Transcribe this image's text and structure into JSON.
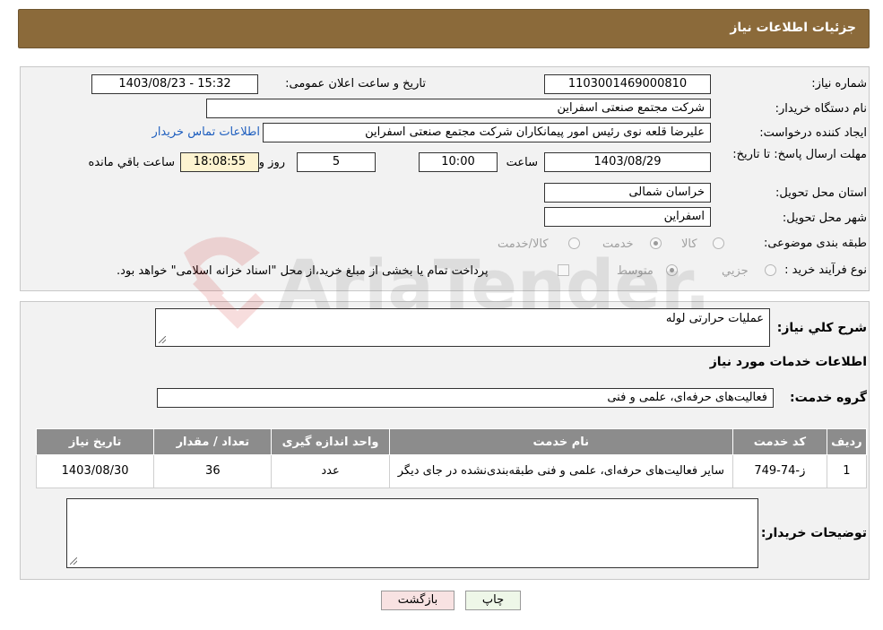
{
  "header": {
    "title": "جزئیات اطلاعات نیاز"
  },
  "labels": {
    "need_number": "شماره نیاز:",
    "announce_datetime": "تاریخ و ساعت اعلان عمومی:",
    "buyer_org": "نام دستگاه خریدار:",
    "requester": "ایجاد کننده درخواست:",
    "buyer_contact": "اطلاعات تماس خریدار",
    "deadline": "مهلت ارسال پاسخ: تا تاریخ:",
    "hour": "ساعت",
    "day_and": "روز و",
    "remaining": "ساعت باقي مانده",
    "province": "استان محل تحویل:",
    "city": "شهر محل تحویل:",
    "category": "طبقه بندی موضوعی:",
    "purchase_type": "نوع فرآیند خرید :",
    "description": "شرح کلي نياز:",
    "services_info": "اطلاعات خدمات مورد نیاز",
    "service_group": "گروه خدمت:",
    "buyer_notes": "توضیحات خریدار:"
  },
  "values": {
    "need_number": "1103001469000810",
    "announce_datetime": "1403/08/23 - 15:32",
    "buyer_org": "شرکت مجتمع صنعتی اسفراین",
    "requester": "علیرضا قلعه نوی رئیس امور پیمانکاران شرکت مجتمع صنعتی اسفراین",
    "deadline_date": "1403/08/29",
    "deadline_hour": "10:00",
    "days": "5",
    "remaining_time": "18:08:55",
    "province": "خراسان شمالی",
    "city": "اسفراین",
    "description": "عملیات حرارتی لوله",
    "service_group": "فعالیت‌های حرفه‌ای، علمی و فنی",
    "buyer_notes": ""
  },
  "category_options": [
    {
      "label": "کالا",
      "selected": false
    },
    {
      "label": "خدمت",
      "selected": true
    },
    {
      "label": "کالا/خدمت",
      "selected": false
    }
  ],
  "purchase_options": [
    {
      "label": "جزیي",
      "selected": false
    },
    {
      "label": "متوسط",
      "selected": true
    }
  ],
  "payment_note": "پرداخت تمام یا بخشی از مبلغ خرید،از محل \"اسناد خزانه اسلامی\" خواهد بود.",
  "table": {
    "headers": [
      "ردیف",
      "کد خدمت",
      "نام خدمت",
      "واحد اندازه گیری",
      "تعداد / مقدار",
      "تاریخ نیاز"
    ],
    "rows": [
      [
        "1",
        "ز-74-749",
        "سایر فعالیت‌های حرفه‌ای، علمی و فنی طبقه‌بندی‌نشده در جای دیگر",
        "عدد",
        "36",
        "1403/08/30"
      ]
    ]
  },
  "buttons": {
    "print": "چاپ",
    "back": "بازگشت"
  },
  "watermark": {
    "text": "AriaTender.neT"
  },
  "colors": {
    "header": "#8b6a3a",
    "table_header": "#8c8c8c",
    "link": "#1f5fbf",
    "print_btn": "#eef7e8",
    "back_btn": "#f8e2e2"
  }
}
